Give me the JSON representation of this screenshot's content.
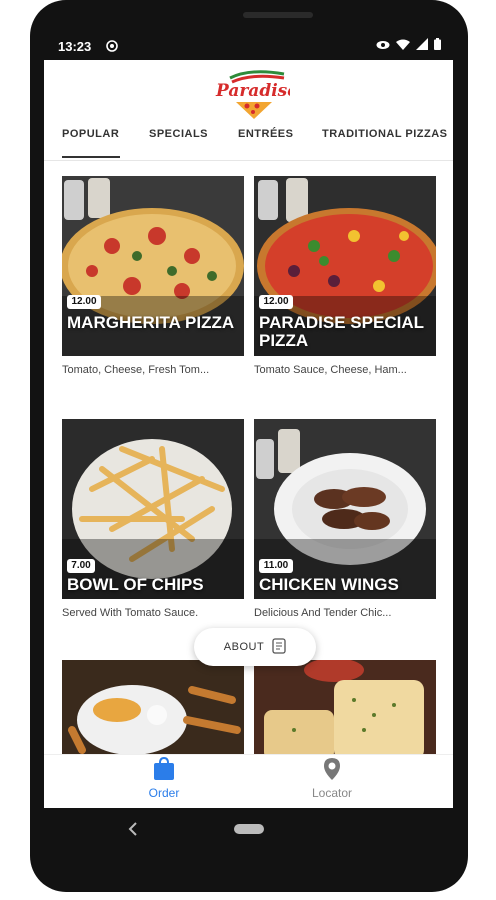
{
  "status_bar": {
    "time": "13:23"
  },
  "tabs": [
    {
      "label": "POPULAR",
      "active": true
    },
    {
      "label": "SPECIALS"
    },
    {
      "label": "ENTRÉES"
    },
    {
      "label": "TRADITIONAL PIZZAS"
    }
  ],
  "items": [
    {
      "price": "12.00",
      "name": "MARGHERITA PIZZA",
      "desc": "Tomato, Cheese, Fresh Tom..."
    },
    {
      "price": "12.00",
      "name": "PARADISE SPECIAL PIZZA",
      "desc": "Tomato Sauce, Cheese, Ham..."
    },
    {
      "price": "7.00",
      "name": "BOWL OF CHIPS",
      "desc": "Served With Tomato Sauce."
    },
    {
      "price": "11.00",
      "name": "CHICKEN WINGS",
      "desc": "Delicious And Tender Chic..."
    }
  ],
  "about": {
    "label": "ABOUT"
  },
  "bottom_nav": [
    {
      "label": "Order",
      "icon": "shopping-bag-icon",
      "active": true
    },
    {
      "label": "Locator",
      "icon": "location-pin-icon"
    }
  ],
  "colors": {
    "accent": "#2b7de9",
    "inactive": "#888888"
  }
}
